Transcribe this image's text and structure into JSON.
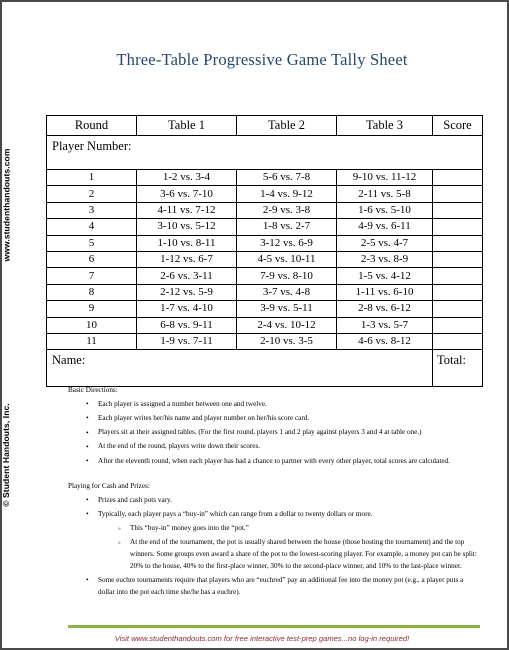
{
  "document": {
    "title": "Three-Table Progressive Game Tally Sheet",
    "side_url": "www.studenthandouts.com",
    "side_copyright": "© Student Handouts, Inc.",
    "footer_note": "Visit www.studenthandouts.com for free interactive test-prep games...no log-in required!",
    "title_color": "#24466f",
    "rule_color": "#8cb04a",
    "footer_color": "#8f2b2b",
    "border_color": "#4a4a4a"
  },
  "tally_table": {
    "player_number_label": "Player Number:",
    "headers": [
      "Round",
      "Table 1",
      "Table 2",
      "Table 3",
      "Score"
    ],
    "rows": [
      {
        "round": "1",
        "table1": "1-2 vs. 3-4",
        "table2": "5-6 vs. 7-8",
        "table3": "9-10 vs. 11-12",
        "score": ""
      },
      {
        "round": "2",
        "table1": "3-6 vs. 7-10",
        "table2": "1-4 vs. 9-12",
        "table3": "2-11 vs. 5-8",
        "score": ""
      },
      {
        "round": "3",
        "table1": "4-11 vs. 7-12",
        "table2": "2-9 vs. 3-8",
        "table3": "1-6 vs. 5-10",
        "score": ""
      },
      {
        "round": "4",
        "table1": "3-10 vs. 5-12",
        "table2": "1-8 vs. 2-7",
        "table3": "4-9 vs. 6-11",
        "score": ""
      },
      {
        "round": "5",
        "table1": "1-10 vs. 8-11",
        "table2": "3-12 vs. 6-9",
        "table3": "2-5 vs. 4-7",
        "score": ""
      },
      {
        "round": "6",
        "table1": "1-12 vs. 6-7",
        "table2": "4-5 vs. 10-11",
        "table3": "2-3 vs. 8-9",
        "score": ""
      },
      {
        "round": "7",
        "table1": "2-6 vs. 3-11",
        "table2": "7-9 vs. 8-10",
        "table3": "1-5 vs. 4-12",
        "score": ""
      },
      {
        "round": "8",
        "table1": "2-12 vs. 5-9",
        "table2": "3-7 vs. 4-8",
        "table3": "1-11 vs. 6-10",
        "score": ""
      },
      {
        "round": "9",
        "table1": "1-7 vs. 4-10",
        "table2": "3-9 vs. 5-11",
        "table3": "2-8 vs. 6-12",
        "score": ""
      },
      {
        "round": "10",
        "table1": "6-8 vs. 9-11",
        "table2": "2-4 vs. 10-12",
        "table3": "1-3 vs. 5-7",
        "score": ""
      },
      {
        "round": "11",
        "table1": "1-9 vs. 7-11",
        "table2": "2-10 vs. 3-5",
        "table3": "4-6 vs. 8-12",
        "score": ""
      }
    ],
    "name_label": "Name:",
    "total_label": "Total:"
  },
  "directions": {
    "heading": "Basic Directions:",
    "bullets": [
      "Each player is assigned a number between one and twelve.",
      "Each player writes her/his name and player number on her/his score card.",
      "Players sit at their assigned tables.  (For the first round, players 1 and 2 play against players 3 and 4 at table one.)",
      "At the end of the round, players write down their scores.",
      "After the eleventh round, when each player has had a chance to partner with every other player, total scores are calculated."
    ]
  },
  "cash_prizes": {
    "heading": "Playing for Cash and Prizes:",
    "bullet_1": "Prizes and cash pots vary.",
    "bullet_2": "Typically, each player pays a “buy-in” which can range from a dollar to twenty dollars or more.",
    "subbullet_1": "This “buy-in” money goes into the “pot.”",
    "subbullet_2": "At the end of the tournament, the pot is usually shared between the house (those hosting the tournament) and the top winners.  Some groups even award a share of the pot to the lowest-scoring player.   For example, a money pot can be split: 20% to the house, 40% to the first-place winner, 30% to the second-place winner, and 10% to the last-place winner.",
    "bullet_3": "Some euchre tournaments require that players who are “euchred” pay an additional fee into the money pot (e.g., a player puts a dollar into the pot each time she/he has a euchre)."
  }
}
